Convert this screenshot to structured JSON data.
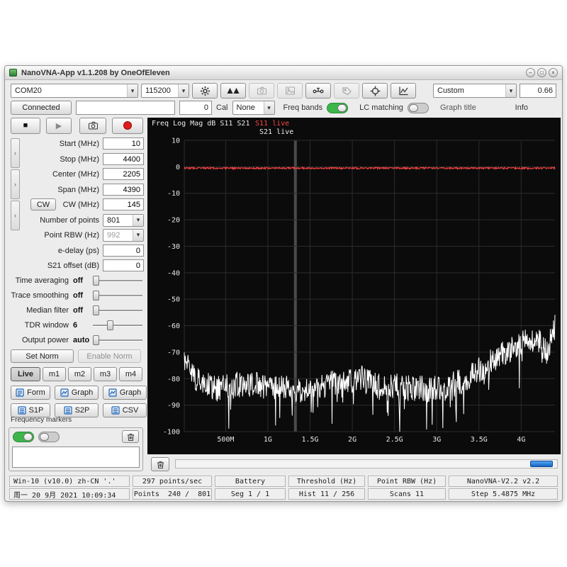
{
  "window": {
    "title": "NanoVNA-App v1.1.208 by OneOfEleven"
  },
  "icons": {
    "dropdown_glyph": "▾",
    "expander_glyph": "›",
    "minimize_glyph": "−",
    "maximize_glyph": "□",
    "close_glyph": "×",
    "play_glyph": "▶",
    "stop_glyph": "■"
  },
  "toolbar": {
    "com_port": "COM20",
    "baud": "115200",
    "preset": "Custom",
    "scale_value": "0.66"
  },
  "toolbar2": {
    "connected_label": "Connected",
    "address_value": "",
    "offset_value": "0",
    "cal_label": "Cal",
    "cal_value": "None",
    "freq_bands_label": "Freq bands",
    "lc_matching_label": "LC matching",
    "graph_title_label": "Graph title",
    "info_label": "Info"
  },
  "sidebar": {
    "fields": [
      {
        "label": "Start (MHz)",
        "value": "10"
      },
      {
        "label": "Stop (MHz)",
        "value": "4400"
      },
      {
        "label": "Center (MHz)",
        "value": "2205"
      },
      {
        "label": "Span (MHz)",
        "value": "4390"
      },
      {
        "label": "CW (MHz)",
        "value": "145"
      },
      {
        "label": "Number of points",
        "value": "801"
      },
      {
        "label": "Point RBW (Hz)",
        "value": "992"
      },
      {
        "label": "e-delay (ps)",
        "value": "0"
      },
      {
        "label": "S21 offset (dB)",
        "value": "0"
      }
    ],
    "cw_button": "CW",
    "sliders": [
      {
        "label": "Time averaging",
        "value": "off",
        "pos": 0
      },
      {
        "label": "Trace smoothing",
        "value": "off",
        "pos": 0
      },
      {
        "label": "Median filter",
        "value": "off",
        "pos": 0
      },
      {
        "label": "TDR window",
        "value": "6",
        "pos": 33
      },
      {
        "label": "Output power",
        "value": "auto",
        "pos": 0
      }
    ],
    "set_norm": "Set Norm",
    "enable_norm": "Enable Norm",
    "tabs": [
      "Live",
      "m1",
      "m2",
      "m3",
      "m4"
    ],
    "export_buttons": [
      "Form",
      "Graph",
      "Graph"
    ],
    "file_buttons": [
      "S1P",
      "S2P",
      "CSV"
    ],
    "freq_markers_label": "Frequency markers"
  },
  "chart": {
    "header": "Freq Log Mag dB S11 S21",
    "s11_legend": "S11 live",
    "s21_legend": "S21 live"
  },
  "chart_data": {
    "type": "line",
    "title": "Freq Log Mag dB S11 S21",
    "bg": "#0b0b0b",
    "grid_color": "#2c2c2c",
    "text_color": "#e8e8e8",
    "sweep_marker_mhz": 1326,
    "sweep_marker_color": "#4a4a4a",
    "seed": 1234567,
    "x_axis": {
      "label": "Frequency",
      "scale": "linear",
      "min_mhz": 10,
      "max_mhz": 4400,
      "ticks": [
        {
          "mhz": 500,
          "label": "500M"
        },
        {
          "mhz": 1000,
          "label": "1G"
        },
        {
          "mhz": 1500,
          "label": "1.5G"
        },
        {
          "mhz": 2000,
          "label": "2G"
        },
        {
          "mhz": 2500,
          "label": "2.5G"
        },
        {
          "mhz": 3000,
          "label": "3G"
        },
        {
          "mhz": 3500,
          "label": "3.5G"
        },
        {
          "mhz": 4000,
          "label": "4G"
        }
      ]
    },
    "y_axis": {
      "label": "dB",
      "min": -100,
      "max": 10,
      "ticks": [
        10,
        0,
        -10,
        -20,
        -30,
        -40,
        -50,
        -60,
        -70,
        -80,
        -90,
        -100
      ]
    },
    "series": [
      {
        "name": "S21 live",
        "color": "#ffffff",
        "type": "noise",
        "points": 801,
        "noise_db": 5,
        "spike_prob": 0.06,
        "spike_db": 13,
        "anchors_mhz_db": [
          [
            10,
            -72
          ],
          [
            150,
            -80
          ],
          [
            400,
            -84
          ],
          [
            700,
            -82
          ],
          [
            1000,
            -83
          ],
          [
            1300,
            -84
          ],
          [
            1600,
            -83
          ],
          [
            1900,
            -81
          ],
          [
            2100,
            -80
          ],
          [
            2300,
            -83
          ],
          [
            2600,
            -83
          ],
          [
            2900,
            -84
          ],
          [
            3100,
            -83
          ],
          [
            3300,
            -81
          ],
          [
            3500,
            -77
          ],
          [
            3700,
            -72
          ],
          [
            3900,
            -69
          ],
          [
            4050,
            -66
          ],
          [
            4200,
            -65
          ],
          [
            4300,
            -70
          ],
          [
            4400,
            -60
          ]
        ]
      },
      {
        "name": "S11 live",
        "color": "#ff4444",
        "type": "flat",
        "points": 801,
        "level_db": -0.5,
        "noise_db": 0.35
      }
    ]
  },
  "statusbar": {
    "cells_row1": [
      "Win-10 (v10.0) zh-CN '.'",
      "297 points/sec",
      "Battery",
      "Threshold (Hz)",
      "Point RBW (Hz)",
      "NanoVNA-V2.2 v2.2"
    ],
    "cells_row2": [
      "周一 20 9月 2021 10:09:34",
      "Points  240 /  801",
      "Seg 1 / 1",
      "Hist 11 / 256",
      "Scans 11",
      "Step 5.4875 MHz"
    ]
  }
}
